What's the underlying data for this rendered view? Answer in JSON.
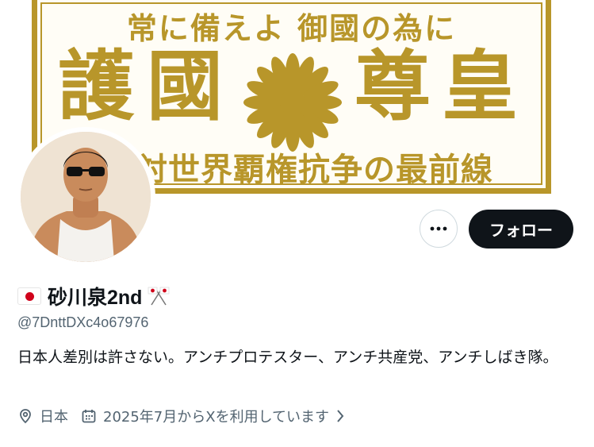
{
  "banner": {
    "line1": "常に備えよ 御國の為に",
    "big_chars": [
      "護",
      "國",
      "尊",
      "皇"
    ],
    "line3": "対世界覇権抗争の最前線"
  },
  "profile": {
    "display_name": "砂川泉2nd",
    "handle": "@7DnttDXc4o67976",
    "bio": "日本人差別は許さない。アンチプロテスター、アンチ共産党、アンチしばき隊。",
    "location": "日本",
    "joined": "2025年7月からXを利用しています"
  },
  "actions": {
    "follow_label": "フォロー",
    "more_icon": "more-icon"
  },
  "icons": {
    "location": "location-pin-icon",
    "calendar": "calendar-icon",
    "chevron": "chevron-right-icon"
  },
  "colors": {
    "banner_gold": "#b8962a",
    "follow_bg": "#0f1419",
    "secondary_text": "#536471",
    "flag_red": "#d0021b"
  }
}
